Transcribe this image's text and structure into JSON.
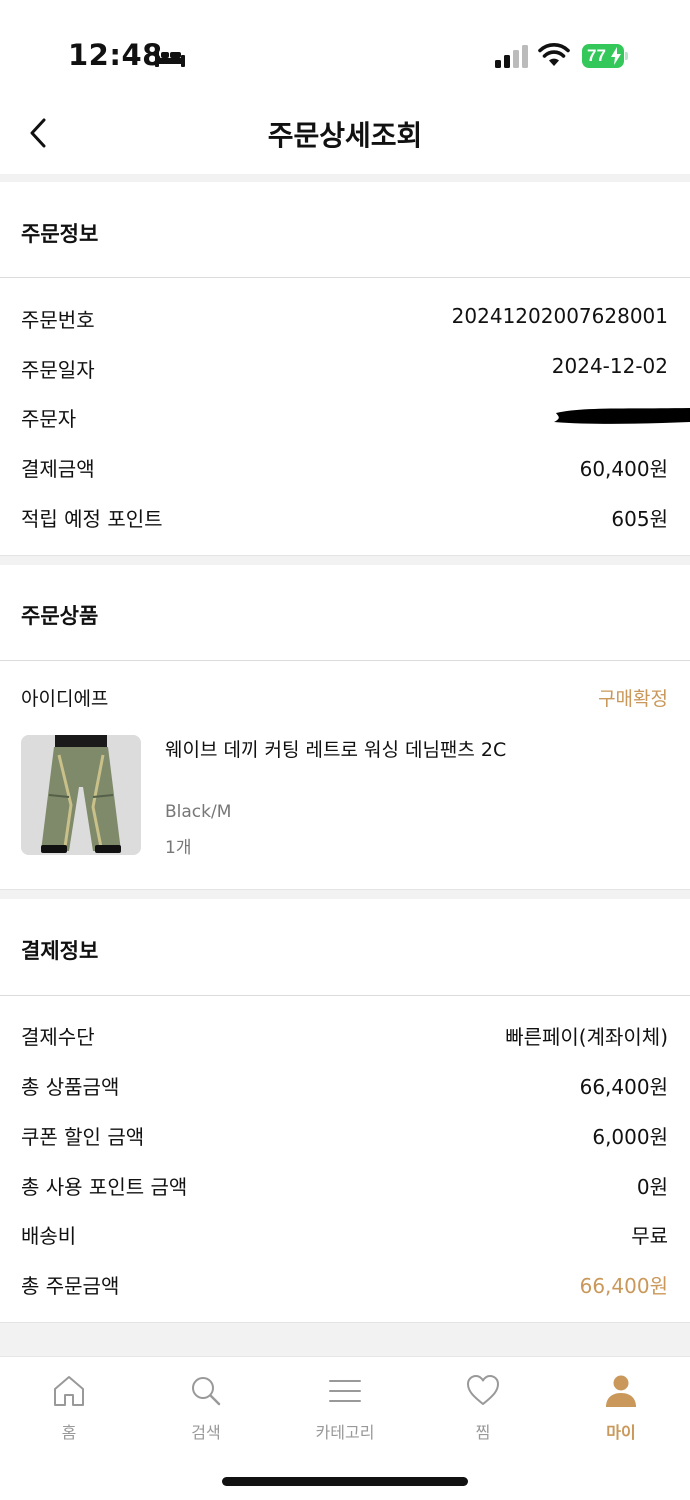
{
  "status_bar": {
    "time": "12:48",
    "battery": "77"
  },
  "header": {
    "title": "주문상세조회"
  },
  "order_info": {
    "title": "주문정보",
    "rows": [
      {
        "label": "주문번호",
        "value": "20241202007628001"
      },
      {
        "label": "주문일자",
        "value": "2024-12-02"
      },
      {
        "label": "주문자",
        "value": ""
      },
      {
        "label": "결제금액",
        "value": "60,400원"
      },
      {
        "label": "적립 예정 포인트",
        "value": "605원"
      }
    ]
  },
  "order_items": {
    "title": "주문상품",
    "seller": "아이디에프",
    "status": "구매확정",
    "product": {
      "name": "웨이브 데끼 커팅 레트로 워싱 데님팬츠 2C",
      "option": "Black/M",
      "quantity": "1개"
    }
  },
  "payment_info": {
    "title": "결제정보",
    "rows": [
      {
        "label": "결제수단",
        "value": "빠른페이(계좌이체)"
      },
      {
        "label": "총 상품금액",
        "value": "66,400원"
      },
      {
        "label": "쿠폰 할인 금액",
        "value": "6,000원"
      },
      {
        "label": "총 사용 포인트 금액",
        "value": "0원"
      },
      {
        "label": "배송비",
        "value": "무료"
      },
      {
        "label": "총 주문금액",
        "value": "66,400원"
      }
    ]
  },
  "bottom_nav": {
    "items": [
      {
        "label": "홈",
        "icon": "home-icon"
      },
      {
        "label": "검색",
        "icon": "search-icon"
      },
      {
        "label": "카테고리",
        "icon": "menu-icon"
      },
      {
        "label": "찜",
        "icon": "heart-icon"
      },
      {
        "label": "마이",
        "icon": "person-icon",
        "active": true
      }
    ]
  },
  "colors": {
    "accent": "#c9985a",
    "battery": "#34c759",
    "divider": "#dcdcdc",
    "gap": "#f2f2f2"
  }
}
